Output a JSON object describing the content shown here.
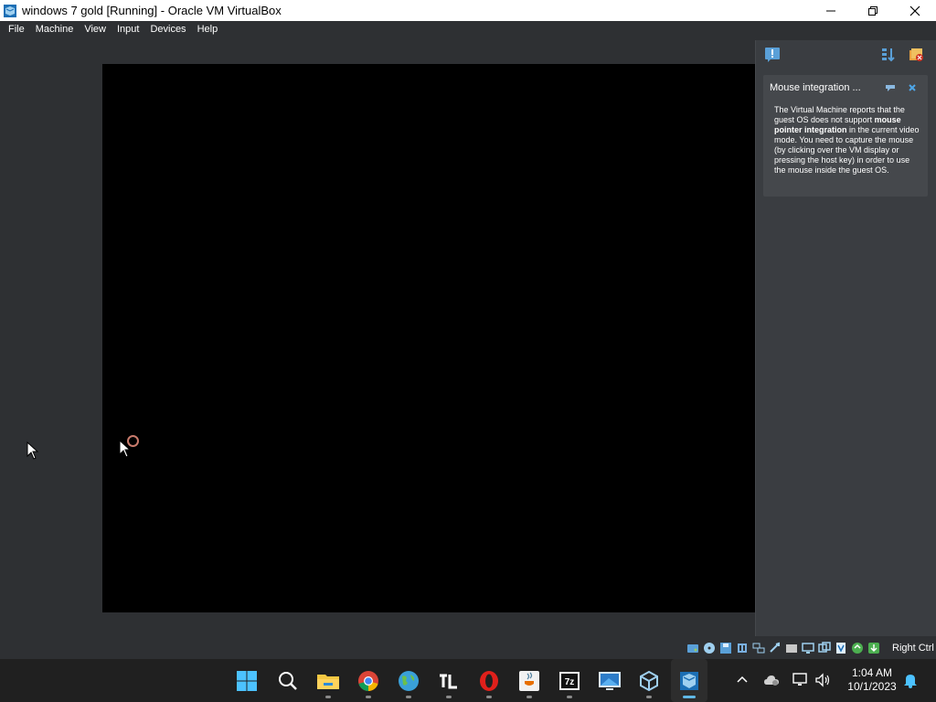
{
  "window": {
    "title": "windows 7 gold [Running] - Oracle VM VirtualBox"
  },
  "menu": [
    "File",
    "Machine",
    "View",
    "Input",
    "Devices",
    "Help"
  ],
  "notification": {
    "title": "Mouse integration ...",
    "body_1": "The Virtual Machine reports that the guest OS does not support ",
    "body_bold": "mouse pointer integration",
    "body_2": " in the current video mode. You need to capture the mouse (by clicking over the VM display or pressing the host key) in order to use the mouse inside the guest OS."
  },
  "statusbar": {
    "host_key": "Right Ctrl",
    "icons": [
      "hard-disk-icon",
      "optical-drive-icon",
      "floppy-icon",
      "audio-icon",
      "network-icon",
      "usb-icon",
      "shared-folders-icon",
      "display-icon",
      "recording-icon",
      "vt-x-icon",
      "mouse-integration-icon",
      "keyboard-capture-icon"
    ]
  },
  "taskbar": {
    "apps": [
      "start",
      "search",
      "file-explorer",
      "chrome",
      "earth-browser",
      "tl-app",
      "opera",
      "java",
      "7zip",
      "remote-desktop",
      "virtualbox",
      "virtualbox-vm"
    ],
    "time": "1:04 AM",
    "date": "10/1/2023"
  },
  "colors": {
    "accent": "#60b8e6",
    "panel": "#3a3d41",
    "vm_background": "#2e3033"
  }
}
